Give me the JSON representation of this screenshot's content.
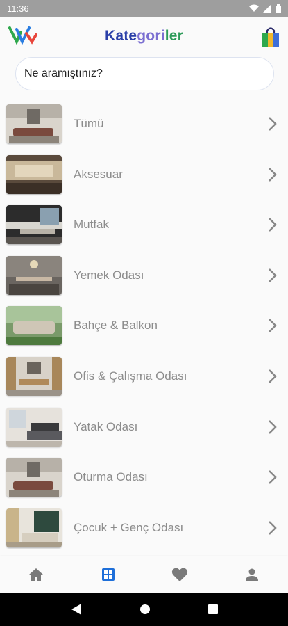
{
  "status": {
    "time": "11:36"
  },
  "header": {
    "title_part1": "Kate",
    "title_part2": "gori",
    "title_part3": "ler",
    "logo_icon": "vv-brand-logo",
    "cart_icon": "shopping-bag-icon"
  },
  "search": {
    "placeholder": "Ne aramıştınız?"
  },
  "categories": [
    {
      "label": "Tümü"
    },
    {
      "label": "Aksesuar"
    },
    {
      "label": "Mutfak"
    },
    {
      "label": "Yemek Odası"
    },
    {
      "label": "Bahçe & Balkon"
    },
    {
      "label": "Ofis & Çalışma Odası"
    },
    {
      "label": "Yatak Odası"
    },
    {
      "label": "Oturma Odası"
    },
    {
      "label": "Çocuk + Genç Odası"
    }
  ],
  "bottom_nav": [
    {
      "icon": "home-icon"
    },
    {
      "icon": "grid-icon",
      "active": true
    },
    {
      "icon": "heart-icon"
    },
    {
      "icon": "profile-icon"
    }
  ],
  "colors": {
    "accent": "#1e6fd9",
    "inactive_icon": "#7a7a7a",
    "label": "#8c8c8c"
  }
}
